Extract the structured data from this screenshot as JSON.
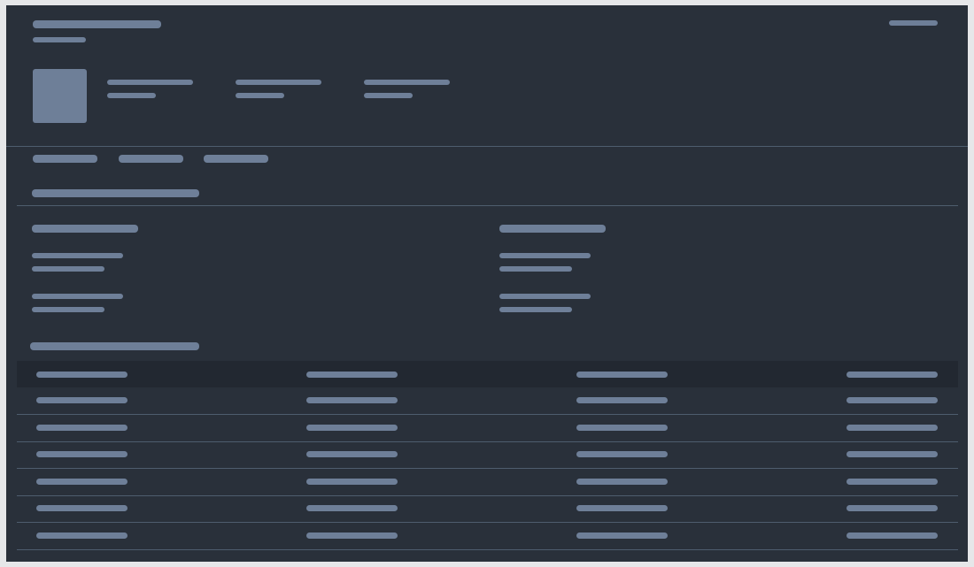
{
  "header": {
    "title": "",
    "subtitle": "",
    "top_right_action": "",
    "stats": [
      {
        "label": "",
        "value": ""
      },
      {
        "label": "",
        "value": ""
      },
      {
        "label": "",
        "value": ""
      }
    ]
  },
  "tabs": [
    {
      "label": ""
    },
    {
      "label": ""
    },
    {
      "label": ""
    }
  ],
  "section_title": "",
  "details": {
    "left": {
      "heading": "",
      "fields": [
        {
          "label": "",
          "value": ""
        },
        {
          "label": "",
          "value": ""
        }
      ]
    },
    "right": {
      "heading": "",
      "fields": [
        {
          "label": "",
          "value": ""
        },
        {
          "label": "",
          "value": ""
        }
      ]
    }
  },
  "table": {
    "title": "",
    "columns": [
      "",
      "",
      "",
      ""
    ],
    "rows": [
      [
        "",
        "",
        "",
        ""
      ],
      [
        "",
        "",
        "",
        ""
      ],
      [
        "",
        "",
        "",
        ""
      ],
      [
        "",
        "",
        "",
        ""
      ],
      [
        "",
        "",
        "",
        ""
      ],
      [
        "",
        "",
        "",
        ""
      ]
    ]
  },
  "colors": {
    "background": "#29303a",
    "placeholder": "#6e7f98",
    "divider": "#4e5d6e",
    "table_header": "#222831",
    "page": "#e6e7e9"
  }
}
